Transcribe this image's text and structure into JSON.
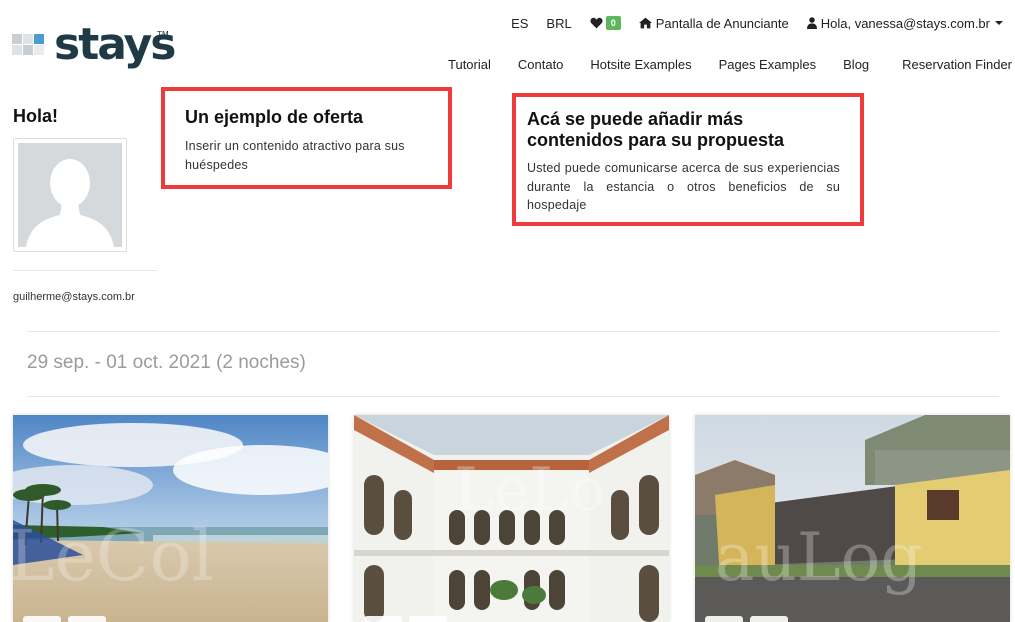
{
  "brand": {
    "logo_text": "stays",
    "logo_tm": "TM"
  },
  "topbar": {
    "language": "ES",
    "currency": "BRL",
    "favorites_count": "0",
    "advertiser_panel": "Pantalla de Anunciante",
    "user_greeting": "Hola, vanessa@stays.com.br"
  },
  "nav": {
    "items": [
      "Tutorial",
      "Contato",
      "Hotsite Examples",
      "Pages Examples",
      "Blog",
      "Reservation Finder"
    ]
  },
  "profile": {
    "title": "Hola!",
    "email": "guilherme@stays.com.br"
  },
  "offers": [
    {
      "title": "Un ejemplo de oferta",
      "text": "Inserir un contenido atractivo para sus huéspedes"
    },
    {
      "title": "Acá se puede añadir más contenidos para su propuesta",
      "text": "Usted puede comunicarse acerca de sus experiencias durante la estancia o otros beneficios de su hospedaje"
    }
  ],
  "booking": {
    "dates": "29 sep. - 01 oct. 2021 (2 noches)"
  },
  "cards": [
    {
      "image": "beach-photo"
    },
    {
      "image": "colonial-courtyard-photo"
    },
    {
      "image": "wooden-houses-photo"
    }
  ],
  "colors": {
    "accent_red": "#ee3b3b",
    "brand_dark": "#1f3a44",
    "badge_green": "#5cb85c",
    "muted_text": "#9b9b9b"
  }
}
